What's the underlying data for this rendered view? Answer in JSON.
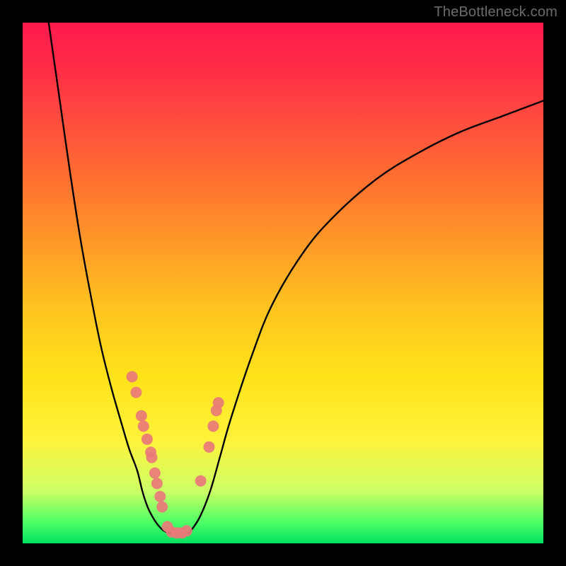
{
  "watermark": "TheBottleneck.com",
  "chart_data": {
    "type": "line",
    "title": "",
    "xlabel": "",
    "ylabel": "",
    "xlim": [
      0,
      100
    ],
    "ylim": [
      0,
      100
    ],
    "grid": false,
    "background_gradient": {
      "top_color": "#ff1a4d",
      "bottom_color": "#00e060",
      "meaning": "vertical position maps to bottleneck severity (top=high, bottom=low)"
    },
    "series": [
      {
        "name": "left-curve",
        "stroke": "#000000",
        "x": [
          5,
          7,
          9,
          11,
          13,
          15,
          17,
          19,
          20.5,
          22,
          23,
          24,
          25,
          26,
          27,
          28
        ],
        "y": [
          100,
          86,
          72,
          59,
          48,
          38,
          30,
          23,
          18,
          14,
          10,
          7,
          5,
          3.5,
          2.5,
          2
        ]
      },
      {
        "name": "floor-segment",
        "stroke": "#000000",
        "x": [
          28,
          30,
          32
        ],
        "y": [
          2,
          2,
          2
        ]
      },
      {
        "name": "right-curve",
        "stroke": "#000000",
        "x": [
          32,
          34,
          36,
          38,
          40,
          44,
          48,
          54,
          60,
          68,
          76,
          84,
          92,
          100
        ],
        "y": [
          2,
          5,
          10,
          17,
          24,
          36,
          46,
          56,
          63,
          70,
          75,
          79,
          82,
          85
        ]
      }
    ],
    "scatter": [
      {
        "name": "left-branch-points",
        "color": "#e97a79",
        "points": [
          {
            "x": 21.0,
            "y": 32.0
          },
          {
            "x": 21.8,
            "y": 29.0
          },
          {
            "x": 22.8,
            "y": 24.5
          },
          {
            "x": 23.2,
            "y": 22.5
          },
          {
            "x": 23.9,
            "y": 20.0
          },
          {
            "x": 24.6,
            "y": 17.5
          },
          {
            "x": 24.8,
            "y": 16.5
          },
          {
            "x": 25.4,
            "y": 13.5
          },
          {
            "x": 25.8,
            "y": 11.5
          },
          {
            "x": 26.4,
            "y": 9.0
          },
          {
            "x": 26.8,
            "y": 7.0
          }
        ]
      },
      {
        "name": "floor-points",
        "color": "#e97a79",
        "points": [
          {
            "x": 27.8,
            "y": 3.2
          },
          {
            "x": 28.6,
            "y": 2.2
          },
          {
            "x": 29.6,
            "y": 2.0
          },
          {
            "x": 30.6,
            "y": 2.0
          },
          {
            "x": 31.5,
            "y": 2.4
          }
        ]
      },
      {
        "name": "right-branch-points",
        "color": "#e97a79",
        "points": [
          {
            "x": 34.2,
            "y": 12.0
          },
          {
            "x": 35.8,
            "y": 18.5
          },
          {
            "x": 36.6,
            "y": 22.5
          },
          {
            "x": 37.2,
            "y": 25.5
          },
          {
            "x": 37.6,
            "y": 27.0
          }
        ]
      }
    ]
  }
}
